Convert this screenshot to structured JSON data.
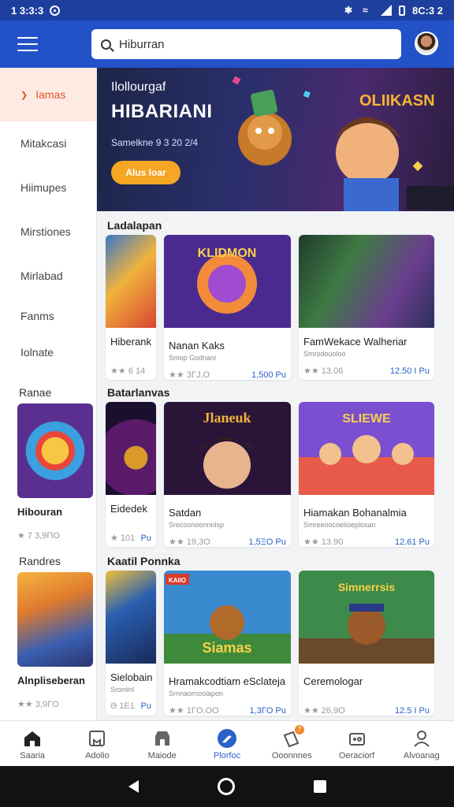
{
  "status": {
    "time": "1 3:3:3",
    "right_time": "8C:3 2"
  },
  "search": {
    "placeholder": "Hiburran",
    "value": "Hiburran"
  },
  "sidebar": {
    "items": [
      {
        "label": "Iamas",
        "active": true
      },
      {
        "label": "Mitakcasi"
      },
      {
        "label": "Hiimupes"
      },
      {
        "label": "Mirstiones"
      },
      {
        "label": "Mirlabad"
      },
      {
        "label": "Fanms"
      },
      {
        "label": "Iolnate"
      }
    ],
    "sections": [
      {
        "title": "Ranae",
        "card": {
          "name": "Hibouran",
          "rating": "★ 7 3,9ΠO"
        }
      },
      {
        "title": "Randres",
        "card": {
          "name": "Alnpliseberan",
          "rating": "★★ 3,9ΓO"
        }
      }
    ]
  },
  "banner": {
    "subtitle": "Ilollourgaf",
    "title": "HIBARIANI",
    "date": "Samelkne 9 3 20 2/4",
    "cta": "Alus Ioar",
    "art_logo": "OLIIKASN"
  },
  "sections": [
    {
      "title": "Ladalapan",
      "cards": [
        {
          "name": "Hiberank",
          "meta": "",
          "stars": "★★ 6 14",
          "price": ""
        },
        {
          "name": "Nanan Kaks",
          "meta": "Smop Godnani",
          "stars": "★★ 3ΓJ,O",
          "price": "1,500 Pu",
          "art": "KLIDMON"
        },
        {
          "name": "FamWekace Walheriar",
          "meta": "Smrodouoloo",
          "stars": "★★ 13.06",
          "price": "12.50 I Pu"
        }
      ]
    },
    {
      "title": "Batarlanvas",
      "cards": [
        {
          "name": "Eidedek",
          "meta": "",
          "stars": "★ 101",
          "price": "Pu"
        },
        {
          "name": "Satdan",
          "meta": "Srecoonoonnnlsp",
          "stars": "★★ 19,3O",
          "price": "1,5ΞO Pu",
          "art": "Jlaneuk"
        },
        {
          "name": "Hiamakan Bohanalmia",
          "meta": "Smreeoocoeiloeplosan",
          "stars": "★★ 13.90",
          "price": "12.61 Pu",
          "art": "SLIEWE"
        }
      ]
    },
    {
      "title": "Kaatil Ponnka",
      "cards": [
        {
          "name": "Sielobain",
          "meta": "Sroniinl",
          "stars": "Ə 1E1",
          "price": "Pu"
        },
        {
          "name": "Hramakcodtiam eSclateja",
          "meta": "Srnnaornoolapon",
          "stars": "★★ 1ΓΟ.ΟΟ",
          "price": "1,3ΓΟ Pu",
          "art": "Siamas",
          "tag": "KAIIO"
        },
        {
          "name": "Ceremologar",
          "meta": "",
          "stars": "★★ 26,9Ο",
          "price": "12.5 I Pu",
          "art": "Simnerrsis"
        }
      ]
    }
  ],
  "bottom_nav": [
    {
      "label": "Saaria",
      "icon": "home-icon"
    },
    {
      "label": "Adolio",
      "icon": "bookmark-icon"
    },
    {
      "label": "Maiode",
      "icon": "store-icon"
    },
    {
      "label": "Plorfoc",
      "icon": "compass-icon",
      "active": true
    },
    {
      "label": "Ooonnnes",
      "icon": "tag-icon",
      "badge": "7"
    },
    {
      "label": "Oeraciorf",
      "icon": "gamepad-icon"
    },
    {
      "label": "Alvoanag",
      "icon": "person-icon"
    }
  ],
  "colors": {
    "appbar": "#2352c8",
    "accent": "#e2542a",
    "price": "#2a61c9",
    "cta": "#f5a623"
  }
}
